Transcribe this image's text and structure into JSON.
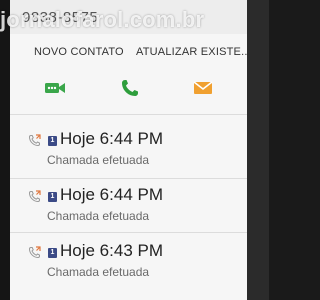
{
  "header": {
    "phone_number": "9838-8575"
  },
  "actions": {
    "new_contact": "NOVO CONTATO",
    "update_existing": "ATUALIZAR EXISTE..."
  },
  "icons": {
    "video": "video-call-icon",
    "call": "phone-icon",
    "message": "envelope-icon"
  },
  "colors": {
    "video": "#3aa64a",
    "call": "#2e9e3c",
    "message": "#f0a030",
    "outgoing": "#e07840"
  },
  "call_log": [
    {
      "time": "Hoje 6:44 PM",
      "status": "Chamada efetuada",
      "sim": "1"
    },
    {
      "time": "Hoje 6:44 PM",
      "status": "Chamada efetuada",
      "sim": "1"
    },
    {
      "time": "Hoje 6:43 PM",
      "status": "Chamada efetuada",
      "sim": "1"
    }
  ],
  "watermark": "jornalofarol.com.br"
}
